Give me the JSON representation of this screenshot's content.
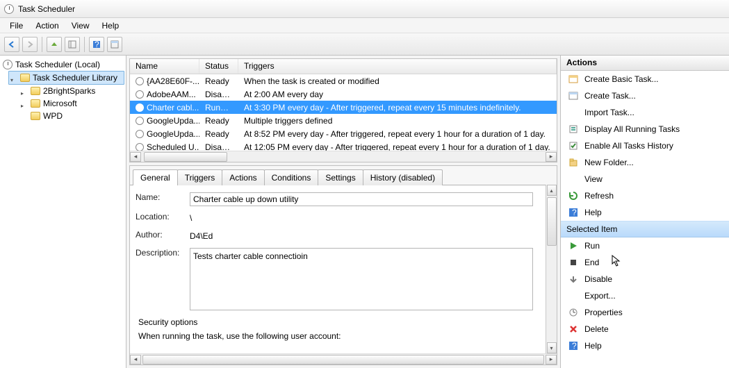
{
  "window": {
    "title": "Task Scheduler"
  },
  "menu": {
    "file": "File",
    "action": "Action",
    "view": "View",
    "help": "Help"
  },
  "tree": {
    "root": "Task Scheduler (Local)",
    "library": "Task Scheduler Library",
    "children": [
      "2BrightSparks",
      "Microsoft",
      "WPD"
    ]
  },
  "list": {
    "headers": {
      "name": "Name",
      "status": "Status",
      "triggers": "Triggers"
    },
    "rows": [
      {
        "name": "{AA28E60F-...",
        "status": "Ready",
        "triggers": "When the task is created or modified",
        "selected": false
      },
      {
        "name": "AdobeAAM...",
        "status": "Disabled",
        "triggers": "At 2:00 AM every day",
        "selected": false
      },
      {
        "name": "Charter cabl...",
        "status": "Running",
        "triggers": "At 3:30 PM every day - After triggered, repeat every 15 minutes indefinitely.",
        "selected": true
      },
      {
        "name": "GoogleUpda...",
        "status": "Ready",
        "triggers": "Multiple triggers defined",
        "selected": false
      },
      {
        "name": "GoogleUpda...",
        "status": "Ready",
        "triggers": "At 8:52 PM every day - After triggered, repeat every 1 hour for a duration of 1 day.",
        "selected": false
      },
      {
        "name": "Scheduled U...",
        "status": "Disabled",
        "triggers": "At 12:05 PM every day - After triggered, repeat every 1 hour for a duration of 1 day.",
        "selected": false
      }
    ]
  },
  "tabs": {
    "general": "General",
    "triggers": "Triggers",
    "actions": "Actions",
    "conditions": "Conditions",
    "settings": "Settings",
    "history": "History (disabled)"
  },
  "details": {
    "name_label": "Name:",
    "name_value": "Charter cable up down utility",
    "location_label": "Location:",
    "location_value": "\\",
    "author_label": "Author:",
    "author_value": "D4\\Ed",
    "description_label": "Description:",
    "description_value": "Tests charter cable connectioin",
    "security_header": "Security options",
    "security_line1": "When running the task, use the following user account:"
  },
  "actions_panel": {
    "header": "Actions",
    "top": [
      "Create Basic Task...",
      "Create Task...",
      "Import Task...",
      "Display All Running Tasks",
      "Enable All Tasks History",
      "New Folder...",
      "View",
      "Refresh",
      "Help"
    ],
    "section": "Selected Item",
    "item": [
      "Run",
      "End",
      "Disable",
      "Export...",
      "Properties",
      "Delete",
      "Help"
    ]
  }
}
